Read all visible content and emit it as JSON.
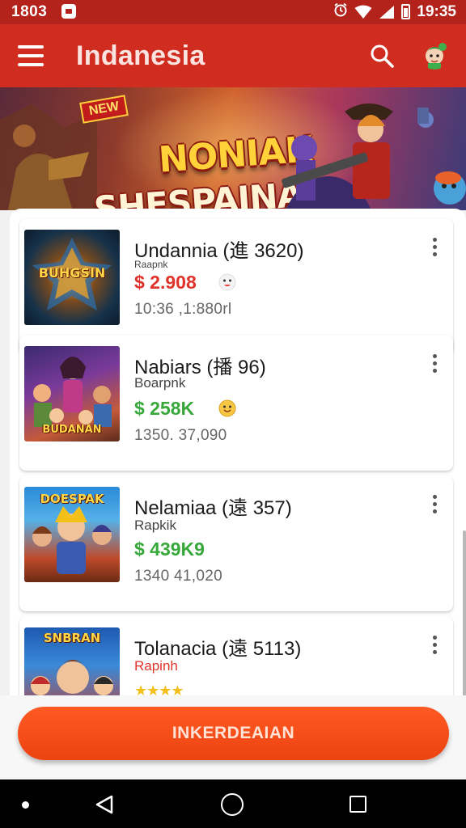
{
  "status_bar": {
    "time_left": "1803",
    "time_right": "19:35",
    "icons": [
      "notification-icon",
      "alarm-icon",
      "wifi-icon",
      "signal-icon",
      "battery-icon"
    ]
  },
  "app_bar": {
    "title": "Indanesia",
    "icons": [
      "menu-icon",
      "search-icon",
      "avatar"
    ]
  },
  "banner": {
    "tag": "NEW",
    "title_line1": "SHESPAINAR",
    "title_line2": "NONIAK"
  },
  "list": {
    "items": [
      {
        "title": "Undannia (進 3620)",
        "subtitle": "Raapnk",
        "price": "$ 2.908",
        "price_color": "#e0322a",
        "meta": "10:36 ,1:880rl",
        "thumb_text": "BUHGSIN"
      },
      {
        "title": "Nabiars (播 96)",
        "subtitle": "Boarpnk",
        "price": "$ 258K",
        "price_color": "#37a83a",
        "meta": "1350. 37,090",
        "thumb_text": "BUDANAN"
      },
      {
        "title": "Nelamiaa (遠 357)",
        "subtitle": "Rapkik",
        "price": "$ 439K9",
        "price_color": "#37a83a",
        "meta": "1340 41,020",
        "thumb_text": "DOESPAK"
      },
      {
        "title": "Tolanacia (遠 5113)",
        "subtitle": "Rapinh",
        "price": "",
        "price_color": "#e0322a",
        "meta": "",
        "thumb_text": "SNBRAN",
        "rating": "★★★★"
      }
    ]
  },
  "cta": {
    "label": "INKERDEAIAN",
    "color": "#ec4311"
  },
  "nav_bar": {
    "icons": [
      "nav-dot",
      "back-icon",
      "home-icon",
      "recents-icon"
    ]
  }
}
